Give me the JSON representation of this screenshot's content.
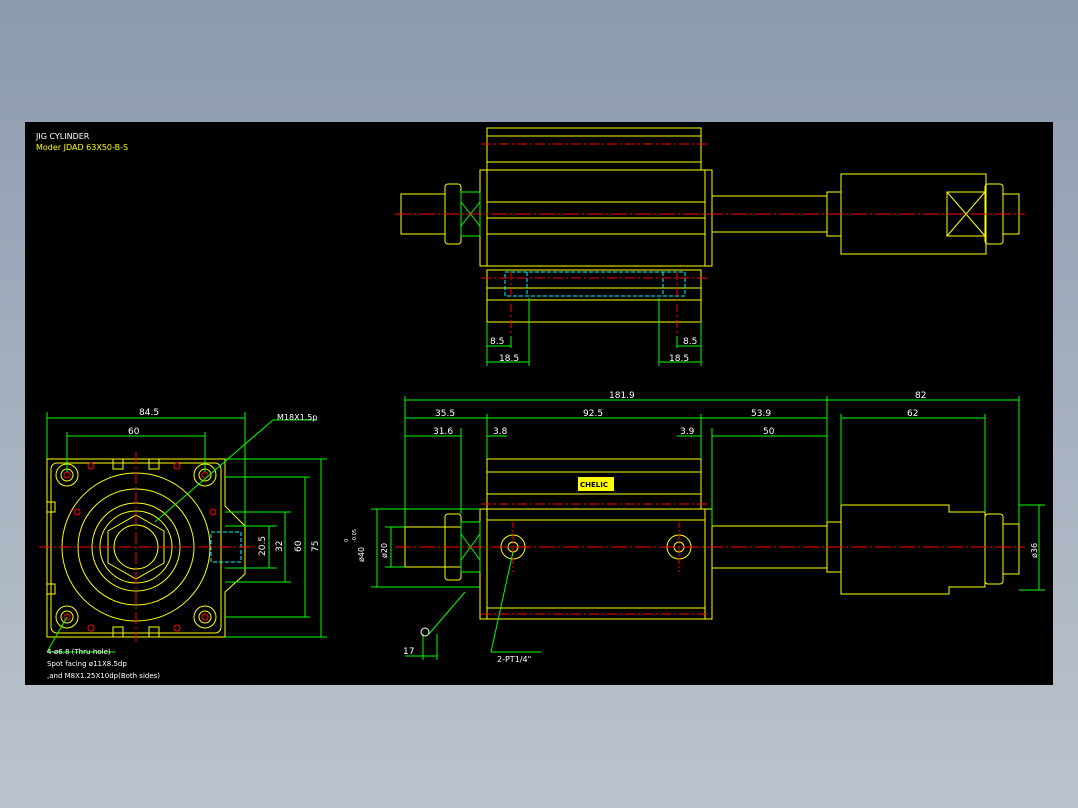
{
  "title": {
    "line1": "JIG CYLINDER",
    "line2": "Moder JDAD 63X50-B-S"
  },
  "colors": {
    "background": "#000000",
    "outline": "#ffff00",
    "dimension": "#00ff00",
    "centerline": "#ff0000",
    "hidden": "#00ffff",
    "frame_gradient_top": "#8b9aae"
  },
  "top_view": {
    "dims": {
      "left_8_5": "8.5",
      "left_18_5": "18.5",
      "right_8_5": "8.5",
      "right_18_5": "18.5"
    }
  },
  "end_view": {
    "dims": {
      "width_84_5": "84.5",
      "width_60": "60",
      "h_20_5": "20.5",
      "h_32": "32",
      "h_60": "60",
      "h_75": "75"
    },
    "callout_thread": "M18X1.5p",
    "notes": [
      "4-ø6.8 (Thru-hole)",
      "Spot facing ø11X8.5dp",
      ",and M8X1.25X10dp(Both sides)"
    ]
  },
  "side_view": {
    "dims": {
      "total_181_9": "181.9",
      "right_82": "82",
      "d35_5": "35.5",
      "d92_5": "92.5",
      "d53_9": "53.9",
      "d62": "62",
      "d31_6": "31.6",
      "d3_8": "3.8",
      "d3_9": "3.9",
      "d50": "50",
      "d17": "17",
      "dia40": "ø40",
      "dia40_tol_upper": "0",
      "dia40_tol_lower": "-0.05",
      "dia20": "ø20",
      "dia36": "ø36"
    },
    "port_note": "2-PT1/4\"",
    "logo_text": "CHELIC"
  }
}
